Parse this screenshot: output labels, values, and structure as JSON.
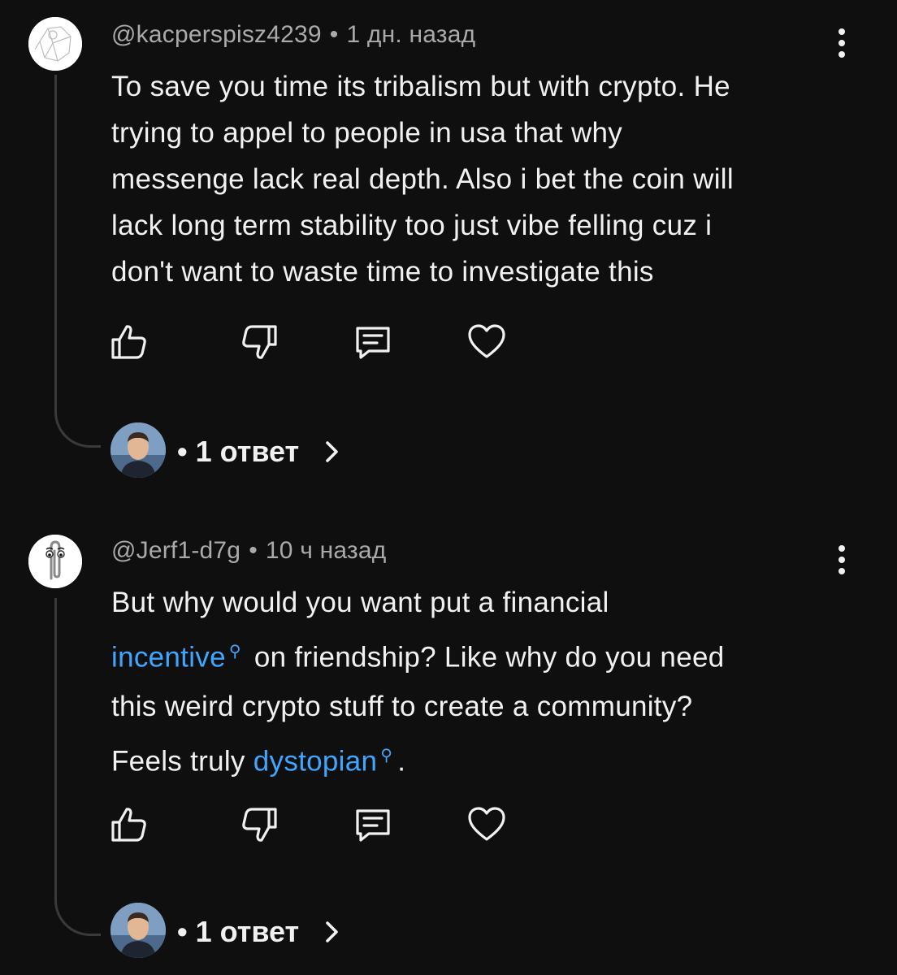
{
  "comments": [
    {
      "author": "@kacperspisz4239",
      "separator": "•",
      "time": "1 дн. назад",
      "text_lines": [
        "To save you time its tribalism but with crypto. He",
        "trying to appel to people in usa that why",
        "messenge lack real depth. Also i bet the coin will",
        "lack long term stability too just vibe felling cuz i",
        "don't want to waste time to investigate this"
      ],
      "avatar_icon": "sketch-avatar",
      "replies_label": "• 1 ответ"
    },
    {
      "author": "@Jerf1-d7g",
      "separator": "•",
      "time": "10 ч назад",
      "text": {
        "l1": "But why would you want put a financial",
        "link1": "incentive",
        "l2": "on friendship? Like why do you need",
        "l3": "this weird crypto stuff to create a community?",
        "l4_pre": "Feels truly",
        "link2": "dystopian",
        "l4_post": "."
      },
      "avatar_icon": "paperclip-avatar",
      "replies_label": "• 1 ответ"
    }
  ],
  "icons": {
    "like": "thumbs-up-icon",
    "dislike": "thumbs-down-icon",
    "reply": "comment-icon",
    "heart": "heart-icon",
    "more": "more-vertical-icon",
    "chevron": "chevron-right-icon",
    "search_hint": "search-icon"
  },
  "colors": {
    "background": "#0f0f0f",
    "text": "#f1f1f1",
    "meta": "#aaaaaa",
    "link": "#3ea6ff",
    "thread": "#3a3a3a"
  }
}
